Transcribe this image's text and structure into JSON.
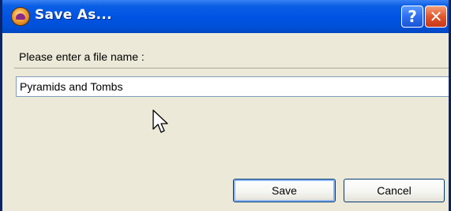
{
  "window": {
    "title": "Save As...",
    "help_label": "?",
    "close_label": "✕"
  },
  "dialog": {
    "prompt": "Please enter a file name :",
    "filename_value": "Pyramids and Tombs",
    "save_label": "Save",
    "cancel_label": "Cancel"
  },
  "colors": {
    "titlebar": "#0054e3",
    "frame": "#0a246a",
    "dialog_background": "#ece9d8",
    "close_button": "#e2552a"
  },
  "icons": {
    "app": "app-icon",
    "help": "help-icon",
    "close": "close-icon",
    "pointer": "mouse-pointer-icon"
  }
}
